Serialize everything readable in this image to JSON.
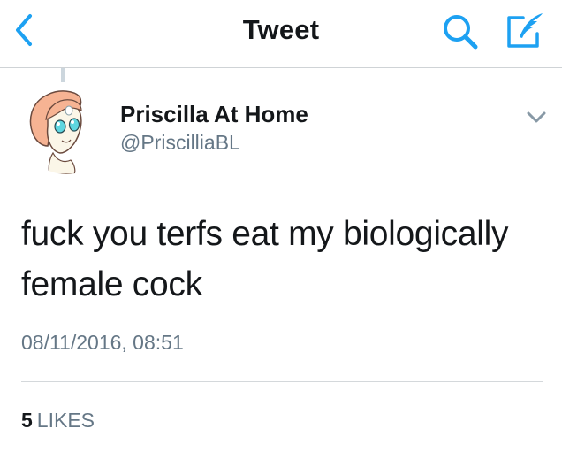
{
  "navbar": {
    "title": "Tweet",
    "back_icon": "chevron-left-icon",
    "search_icon": "search-icon",
    "compose_icon": "compose-tweet-icon",
    "accent_color": "#1da1f2"
  },
  "tweet": {
    "display_name": "Priscilla At Home",
    "handle": "@PriscilliaBL",
    "text_line1": "fuck you terfs eat my biologically",
    "text_line2": "female cock",
    "timestamp": "08/11/2016, 08:51",
    "likes_count": "5",
    "likes_label": "LIKES",
    "menu_icon": "chevron-down-icon"
  }
}
